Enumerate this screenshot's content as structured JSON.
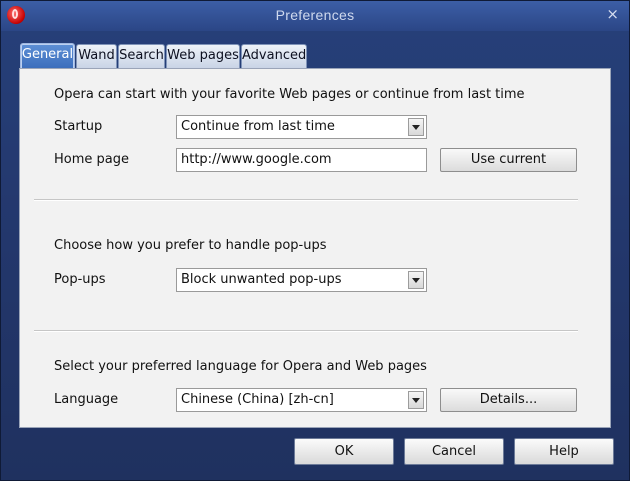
{
  "window": {
    "title": "Preferences",
    "close_glyph": "×",
    "app_icon": "opera-icon"
  },
  "tabs": [
    {
      "label": "General",
      "active": true
    },
    {
      "label": "Wand",
      "active": false
    },
    {
      "label": "Search",
      "active": false
    },
    {
      "label": "Web pages",
      "active": false
    },
    {
      "label": "Advanced",
      "active": false
    }
  ],
  "general": {
    "startup_intro": "Opera can start with your favorite Web pages or continue from last time",
    "startup_label": "Startup",
    "startup_value": "Continue from last time",
    "homepage_label": "Home page",
    "homepage_value": "http://www.google.com",
    "use_current_label": "Use current",
    "popups_intro": "Choose how you prefer to handle pop-ups",
    "popups_label": "Pop-ups",
    "popups_value": "Block unwanted pop-ups",
    "language_intro": "Select your preferred language for Opera and Web pages",
    "language_label": "Language",
    "language_value": "Chinese (China) [zh-cn]",
    "details_label": "Details..."
  },
  "footer": {
    "ok_label": "OK",
    "cancel_label": "Cancel",
    "help_label": "Help"
  }
}
